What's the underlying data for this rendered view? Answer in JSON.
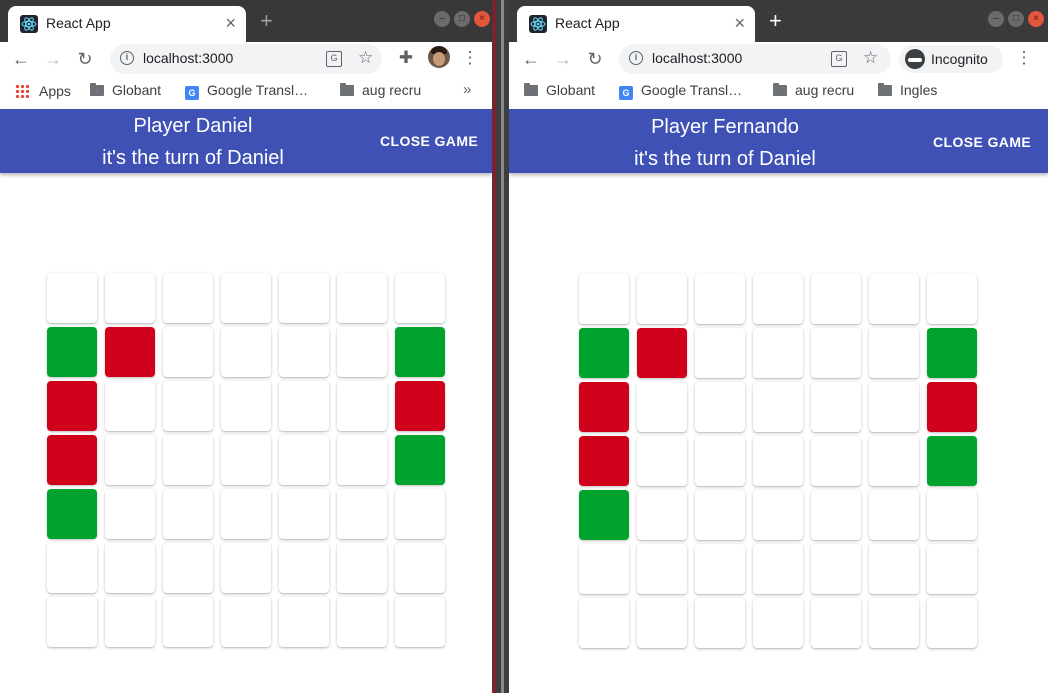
{
  "colors": {
    "app_bar": "#3f51b5",
    "green": "#00a32e",
    "red": "#d0021b",
    "empty": "#ffffff"
  },
  "windows": [
    {
      "tab_title": "React App",
      "url": "localhost:3000",
      "bookmarks": [
        "Apps",
        "Globant",
        "Google Transl…",
        "aug recru"
      ],
      "bookmarks_overflow": "»",
      "profile": "avatar",
      "player_line": "Player Daniel",
      "turn_line": "it's the turn of Daniel",
      "close_label": "CLOSE GAME",
      "board": [
        [
          "empty",
          "empty",
          "empty",
          "empty",
          "empty",
          "empty",
          "empty"
        ],
        [
          "green",
          "red",
          "empty",
          "empty",
          "empty",
          "empty",
          "green"
        ],
        [
          "red",
          "empty",
          "empty",
          "empty",
          "empty",
          "empty",
          "red"
        ],
        [
          "red",
          "empty",
          "empty",
          "empty",
          "empty",
          "empty",
          "green"
        ],
        [
          "green",
          "empty",
          "empty",
          "empty",
          "empty",
          "empty",
          "empty"
        ],
        [
          "empty",
          "empty",
          "empty",
          "empty",
          "empty",
          "empty",
          "empty"
        ],
        [
          "empty",
          "empty",
          "empty",
          "empty",
          "empty",
          "empty",
          "empty"
        ]
      ]
    },
    {
      "tab_title": "React App",
      "url": "localhost:3000",
      "bookmarks": [
        "Globant",
        "Google Transl…",
        "aug recru",
        "Ingles"
      ],
      "profile": "Incognito",
      "player_line": "Player Fernando",
      "turn_line": "it's the turn of Daniel",
      "close_label": "CLOSE GAME",
      "board": [
        [
          "empty",
          "empty",
          "empty",
          "empty",
          "empty",
          "empty",
          "empty"
        ],
        [
          "green",
          "red",
          "empty",
          "empty",
          "empty",
          "empty",
          "green"
        ],
        [
          "red",
          "empty",
          "empty",
          "empty",
          "empty",
          "empty",
          "red"
        ],
        [
          "red",
          "empty",
          "empty",
          "empty",
          "empty",
          "empty",
          "green"
        ],
        [
          "green",
          "empty",
          "empty",
          "empty",
          "empty",
          "empty",
          "empty"
        ],
        [
          "empty",
          "empty",
          "empty",
          "empty",
          "empty",
          "empty",
          "empty"
        ],
        [
          "empty",
          "empty",
          "empty",
          "empty",
          "empty",
          "empty",
          "empty"
        ]
      ]
    }
  ]
}
